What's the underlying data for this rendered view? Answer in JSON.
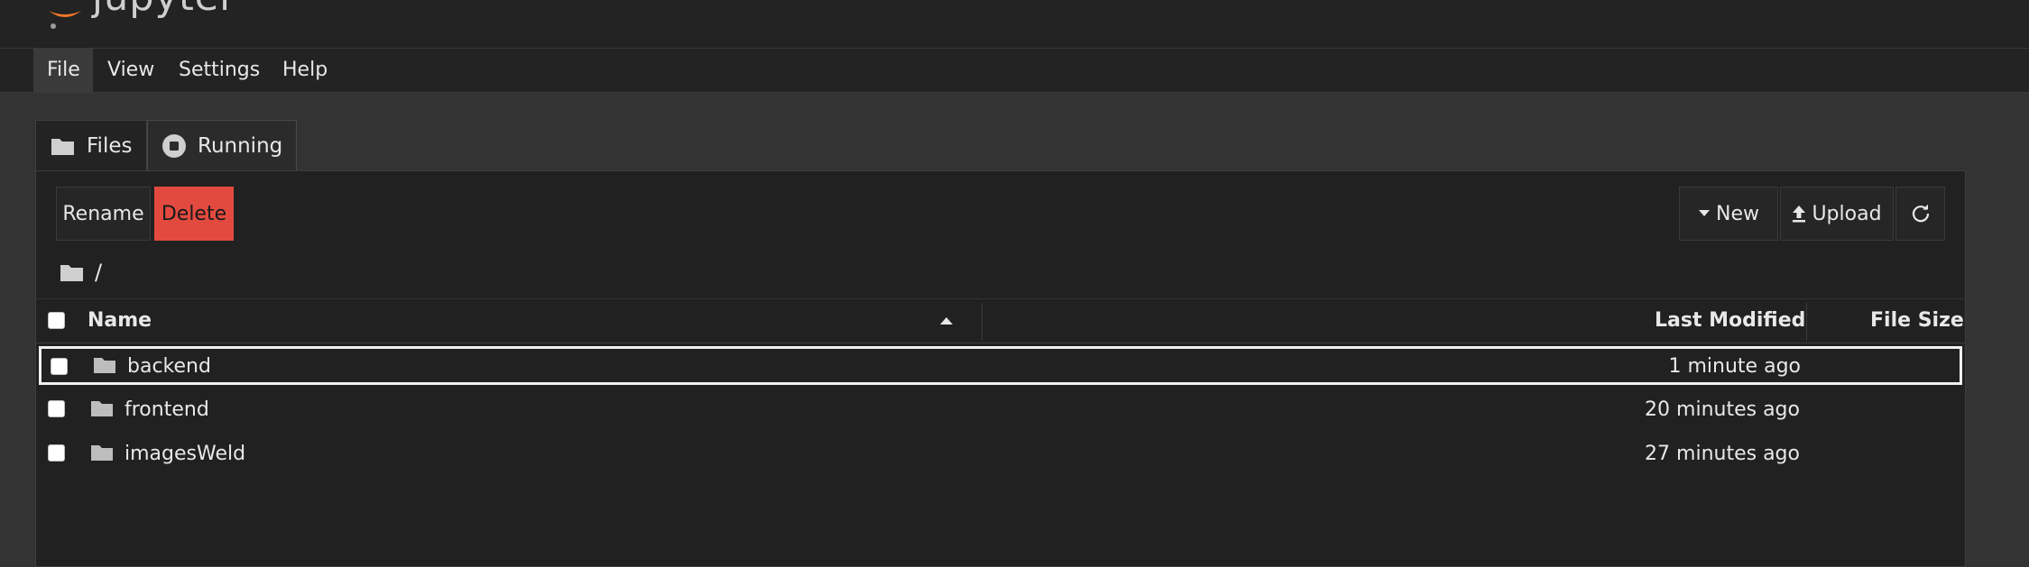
{
  "app": {
    "logo_text": "jupyter"
  },
  "menu": {
    "items": [
      {
        "label": "File"
      },
      {
        "label": "View"
      },
      {
        "label": "Settings"
      },
      {
        "label": "Help"
      }
    ]
  },
  "tabs": [
    {
      "label": "Files",
      "icon": "folder-icon"
    },
    {
      "label": "Running",
      "icon": "stop-circle-icon"
    }
  ],
  "toolbar": {
    "rename_label": "Rename",
    "delete_label": "Delete",
    "new_label": "New",
    "upload_label": "Upload",
    "refresh_icon": "refresh-icon"
  },
  "breadcrumb": {
    "path": "/"
  },
  "table": {
    "columns": {
      "name": "Name",
      "modified": "Last Modified",
      "size": "File Size"
    },
    "sort": {
      "column": "Name",
      "direction": "ascending"
    },
    "rows": [
      {
        "name": "backend",
        "modified": "1 minute ago",
        "size": "",
        "type": "folder",
        "selected": true
      },
      {
        "name": "frontend",
        "modified": "20 minutes ago",
        "size": "",
        "type": "folder",
        "selected": false
      },
      {
        "name": "imagesWeld",
        "modified": "27 minutes ago",
        "size": "",
        "type": "folder",
        "selected": false
      }
    ]
  },
  "colors": {
    "background": "#333333",
    "panel": "#212121",
    "delete_button": "#e34a3f",
    "logo_orange": "#f37726"
  }
}
